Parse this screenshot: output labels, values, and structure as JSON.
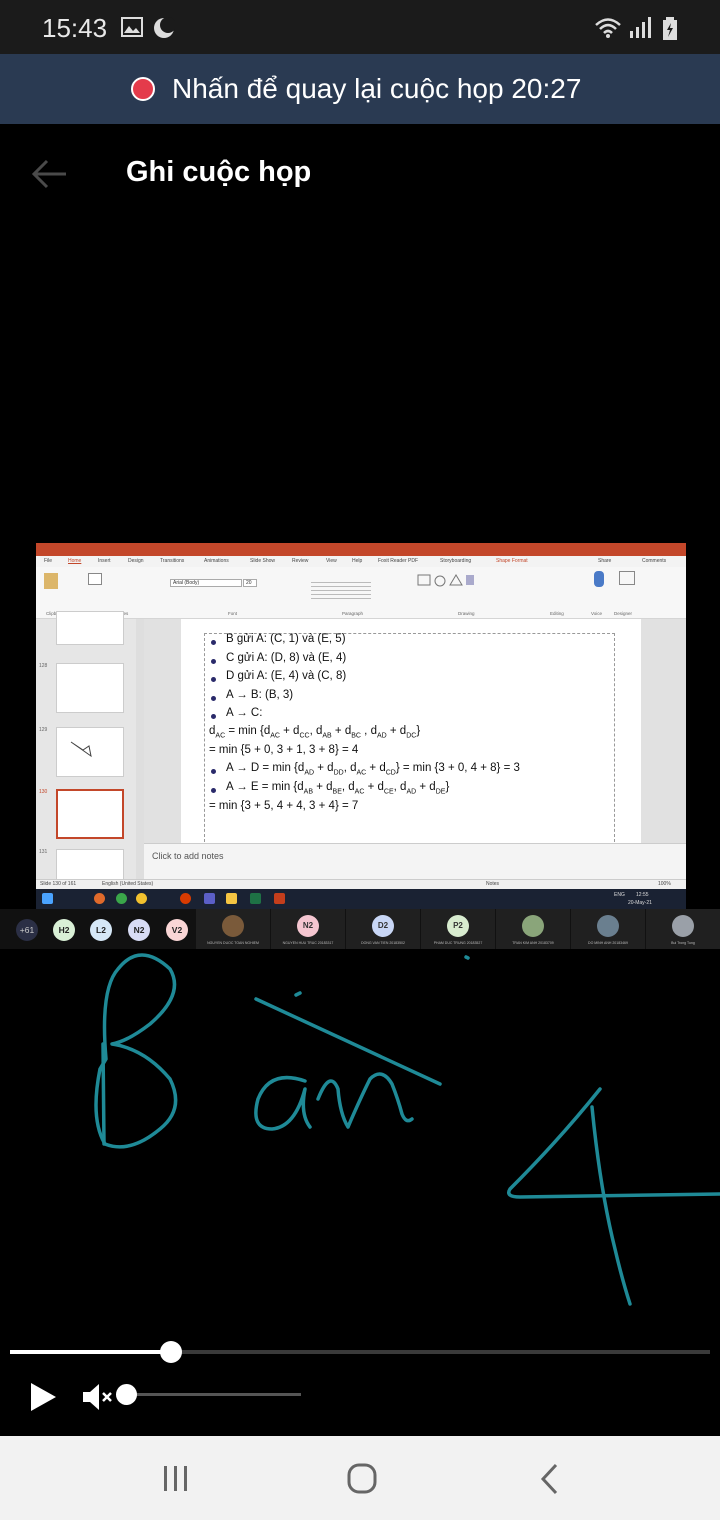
{
  "status_bar": {
    "time": "15:43",
    "icons": [
      "gallery-icon",
      "do-not-disturb-icon",
      "wifi-icon",
      "signal-icon",
      "battery-icon"
    ]
  },
  "banner": {
    "text": "Nhấn để quay lại cuộc họp 20:27",
    "rec_color": "#e43b4b"
  },
  "header": {
    "title": "Ghi cuộc họp"
  },
  "screen_share": {
    "app_tabs": [
      "File",
      "Home",
      "Insert",
      "Design",
      "Transitions",
      "Animations",
      "Slide Show",
      "Review",
      "View",
      "Help",
      "Foxit Reader PDF",
      "Storyboarding",
      "Shape Format"
    ],
    "share_label": "Share",
    "comments_label": "Comments",
    "font_name": "Arial (Body)",
    "font_size": "20",
    "ribbon_groups": [
      "Clipboard",
      "Slides",
      "Font",
      "Paragraph",
      "Drawing",
      "Editing",
      "Voice",
      "Designer"
    ],
    "thumb_numbers": [
      "128",
      "129",
      "130",
      "131"
    ],
    "slide_lines": {
      "b1": "B gửi A: (C, 1) và (E, 5)",
      "b2": "C gửi A: (D, 8) và (E, 4)",
      "b3": "D gửi A: (E, 4) và (C, 8)",
      "b4": "A → B: (B, 3)",
      "b5": "A → C:",
      "eq1a": "d",
      "eq1a_sub": "AC",
      "eq1b": " = min {d",
      "eq1b_sub": "AC",
      "eq1c": " + d",
      "eq1c_sub": "CC",
      "eq1d": ", d",
      "eq1d_sub": "AB",
      "eq1e": " + d",
      "eq1e_sub": "BC",
      "eq1f": " , d",
      "eq1f_sub": "AD",
      "eq1g": " + d",
      "eq1g_sub": "DC",
      "eq1h": "}",
      "eq2": "= min {5 + 0, 3 + 1, 3 + 8} = 4",
      "b6a": "A → D = min {d",
      "b6a_sub": "AD",
      "b6b": " + d",
      "b6b_sub": "DD",
      "b6c": ", d",
      "b6c_sub": "AC",
      "b6d": " + d",
      "b6d_sub": "CD",
      "b6e": "} = min {3 + 0, 4 + 8} = 3",
      "b7a": "A → E = min {d",
      "b7a_sub": "AB",
      "b7b": " + d",
      "b7b_sub": "BE",
      "b7c": ", d",
      "b7c_sub": "AC",
      "b7d": " + d",
      "b7d_sub": "CE",
      "b7e": ", d",
      "b7e_sub": "AD",
      "b7f": " + d",
      "b7f_sub": "DE",
      "b7g": "}",
      "eq3": "= min {3 + 5, 4 + 4, 3 + 4} = 7"
    },
    "notes_placeholder": "Click to add notes",
    "status_slide": "Slide 130 of 161",
    "status_lang": "English (United States)",
    "status_notes": "Notes",
    "status_zoom": "100%",
    "taskbar_time": "12:55",
    "taskbar_date": "20-May-21",
    "taskbar_lang": "ENG"
  },
  "participants": {
    "overflow": "+61",
    "circles": [
      {
        "label": "H2",
        "color": "#d9f0d6"
      },
      {
        "label": "L2",
        "color": "#d6e8f7"
      },
      {
        "label": "N2",
        "color": "#d8dcf5"
      },
      {
        "label": "V2",
        "color": "#fad6d6"
      }
    ],
    "tiles": [
      {
        "initials": "",
        "name": "NGUYEN DUOC TOAN NGHIEM",
        "color": "#7a5a3a"
      },
      {
        "initials": "N2",
        "name": "NGUYEN HUU TRUC 20183317",
        "color": "#f5c6d0"
      },
      {
        "initials": "D2",
        "name": "DONG VAN TIEN 20183502",
        "color": "#c8d6f5"
      },
      {
        "initials": "P2",
        "name": "PHAM DUC TRUNG 20183527",
        "color": "#d8eccf"
      },
      {
        "initials": "",
        "name": "TRAN KIM ANH 20183709",
        "color": "#8aa57a"
      },
      {
        "initials": "",
        "name": "DO MINH ANH 20183469",
        "color": "#6a7f8f"
      },
      {
        "initials": "",
        "name": "Bui Trong Tung",
        "color": "#9aa0a8"
      }
    ]
  },
  "player": {
    "progress": 0.23,
    "volume": 0.0
  },
  "nav": {
    "icons": [
      "recents-icon",
      "home-icon",
      "back-icon"
    ]
  }
}
